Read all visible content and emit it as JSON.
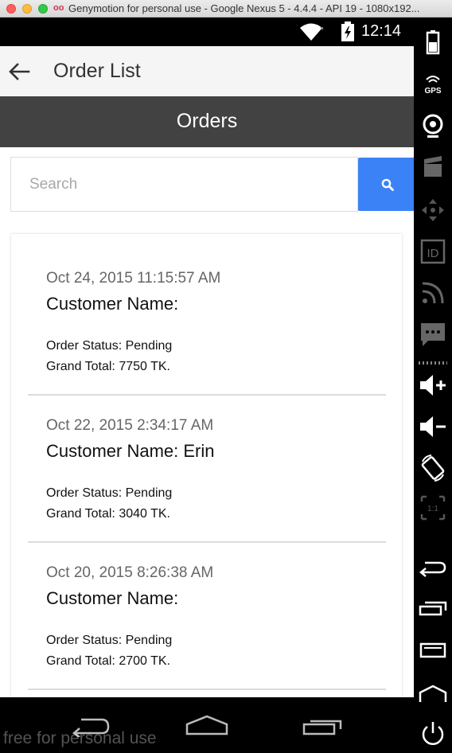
{
  "window": {
    "title": "Genymotion for personal use - Google Nexus 5 - 4.4.4 - API 19 - 1080x192..."
  },
  "status_bar": {
    "time": "12:14"
  },
  "app_bar": {
    "title": "Order List"
  },
  "section_header": {
    "title": "Orders"
  },
  "search": {
    "placeholder": "Search"
  },
  "orders": [
    {
      "date": "Oct 24, 2015 11:15:57 AM",
      "customer": "Customer Name:",
      "status": "Order Status: Pending",
      "total": "Grand Total: 7750 TK."
    },
    {
      "date": "Oct 22, 2015 2:34:17 AM",
      "customer": "Customer Name: Erin",
      "status": "Order Status: Pending",
      "total": "Grand Total: 3040 TK."
    },
    {
      "date": "Oct 20, 2015 8:26:38 AM",
      "customer": "Customer Name:",
      "status": "Order Status: Pending",
      "total": "Grand Total: 2700 TK."
    }
  ],
  "navigation": {
    "watermark": "free for personal use"
  },
  "toolbar": {
    "gps_label": "GPS",
    "id_label": "ID",
    "scale_label": "1:1"
  },
  "colors": {
    "section_header_bg": "#424242",
    "search_button": "#3b82f6",
    "app_bar_bg": "#f5f5f5"
  },
  "icons": {
    "back": "arrow-left-icon",
    "search": "magnifier-icon",
    "battery": "battery-icon",
    "wifi": "wifi-icon"
  }
}
